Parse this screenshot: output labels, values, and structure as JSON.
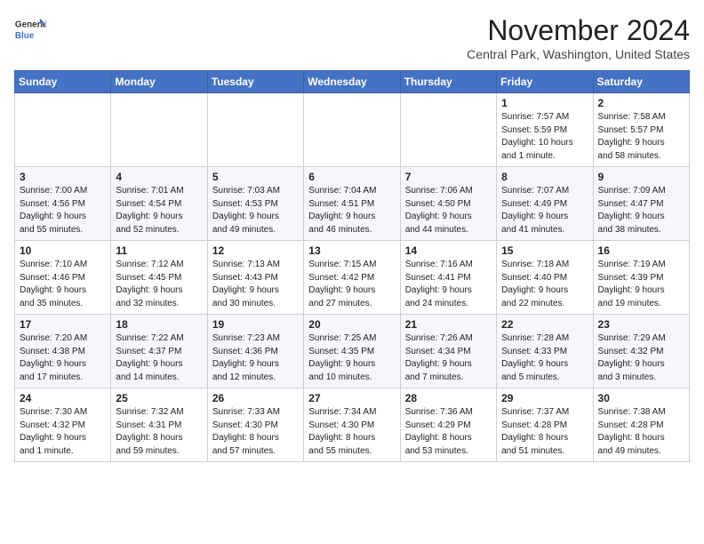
{
  "header": {
    "logo_line1": "General",
    "logo_line2": "Blue",
    "month_title": "November 2024",
    "location": "Central Park, Washington, United States"
  },
  "weekdays": [
    "Sunday",
    "Monday",
    "Tuesday",
    "Wednesday",
    "Thursday",
    "Friday",
    "Saturday"
  ],
  "weeks": [
    [
      {
        "day": "",
        "info": ""
      },
      {
        "day": "",
        "info": ""
      },
      {
        "day": "",
        "info": ""
      },
      {
        "day": "",
        "info": ""
      },
      {
        "day": "",
        "info": ""
      },
      {
        "day": "1",
        "info": "Sunrise: 7:57 AM\nSunset: 5:59 PM\nDaylight: 10 hours\nand 1 minute."
      },
      {
        "day": "2",
        "info": "Sunrise: 7:58 AM\nSunset: 5:57 PM\nDaylight: 9 hours\nand 58 minutes."
      }
    ],
    [
      {
        "day": "3",
        "info": "Sunrise: 7:00 AM\nSunset: 4:56 PM\nDaylight: 9 hours\nand 55 minutes."
      },
      {
        "day": "4",
        "info": "Sunrise: 7:01 AM\nSunset: 4:54 PM\nDaylight: 9 hours\nand 52 minutes."
      },
      {
        "day": "5",
        "info": "Sunrise: 7:03 AM\nSunset: 4:53 PM\nDaylight: 9 hours\nand 49 minutes."
      },
      {
        "day": "6",
        "info": "Sunrise: 7:04 AM\nSunset: 4:51 PM\nDaylight: 9 hours\nand 46 minutes."
      },
      {
        "day": "7",
        "info": "Sunrise: 7:06 AM\nSunset: 4:50 PM\nDaylight: 9 hours\nand 44 minutes."
      },
      {
        "day": "8",
        "info": "Sunrise: 7:07 AM\nSunset: 4:49 PM\nDaylight: 9 hours\nand 41 minutes."
      },
      {
        "day": "9",
        "info": "Sunrise: 7:09 AM\nSunset: 4:47 PM\nDaylight: 9 hours\nand 38 minutes."
      }
    ],
    [
      {
        "day": "10",
        "info": "Sunrise: 7:10 AM\nSunset: 4:46 PM\nDaylight: 9 hours\nand 35 minutes."
      },
      {
        "day": "11",
        "info": "Sunrise: 7:12 AM\nSunset: 4:45 PM\nDaylight: 9 hours\nand 32 minutes."
      },
      {
        "day": "12",
        "info": "Sunrise: 7:13 AM\nSunset: 4:43 PM\nDaylight: 9 hours\nand 30 minutes."
      },
      {
        "day": "13",
        "info": "Sunrise: 7:15 AM\nSunset: 4:42 PM\nDaylight: 9 hours\nand 27 minutes."
      },
      {
        "day": "14",
        "info": "Sunrise: 7:16 AM\nSunset: 4:41 PM\nDaylight: 9 hours\nand 24 minutes."
      },
      {
        "day": "15",
        "info": "Sunrise: 7:18 AM\nSunset: 4:40 PM\nDaylight: 9 hours\nand 22 minutes."
      },
      {
        "day": "16",
        "info": "Sunrise: 7:19 AM\nSunset: 4:39 PM\nDaylight: 9 hours\nand 19 minutes."
      }
    ],
    [
      {
        "day": "17",
        "info": "Sunrise: 7:20 AM\nSunset: 4:38 PM\nDaylight: 9 hours\nand 17 minutes."
      },
      {
        "day": "18",
        "info": "Sunrise: 7:22 AM\nSunset: 4:37 PM\nDaylight: 9 hours\nand 14 minutes."
      },
      {
        "day": "19",
        "info": "Sunrise: 7:23 AM\nSunset: 4:36 PM\nDaylight: 9 hours\nand 12 minutes."
      },
      {
        "day": "20",
        "info": "Sunrise: 7:25 AM\nSunset: 4:35 PM\nDaylight: 9 hours\nand 10 minutes."
      },
      {
        "day": "21",
        "info": "Sunrise: 7:26 AM\nSunset: 4:34 PM\nDaylight: 9 hours\nand 7 minutes."
      },
      {
        "day": "22",
        "info": "Sunrise: 7:28 AM\nSunset: 4:33 PM\nDaylight: 9 hours\nand 5 minutes."
      },
      {
        "day": "23",
        "info": "Sunrise: 7:29 AM\nSunset: 4:32 PM\nDaylight: 9 hours\nand 3 minutes."
      }
    ],
    [
      {
        "day": "24",
        "info": "Sunrise: 7:30 AM\nSunset: 4:32 PM\nDaylight: 9 hours\nand 1 minute."
      },
      {
        "day": "25",
        "info": "Sunrise: 7:32 AM\nSunset: 4:31 PM\nDaylight: 8 hours\nand 59 minutes."
      },
      {
        "day": "26",
        "info": "Sunrise: 7:33 AM\nSunset: 4:30 PM\nDaylight: 8 hours\nand 57 minutes."
      },
      {
        "day": "27",
        "info": "Sunrise: 7:34 AM\nSunset: 4:30 PM\nDaylight: 8 hours\nand 55 minutes."
      },
      {
        "day": "28",
        "info": "Sunrise: 7:36 AM\nSunset: 4:29 PM\nDaylight: 8 hours\nand 53 minutes."
      },
      {
        "day": "29",
        "info": "Sunrise: 7:37 AM\nSunset: 4:28 PM\nDaylight: 8 hours\nand 51 minutes."
      },
      {
        "day": "30",
        "info": "Sunrise: 7:38 AM\nSunset: 4:28 PM\nDaylight: 8 hours\nand 49 minutes."
      }
    ]
  ]
}
